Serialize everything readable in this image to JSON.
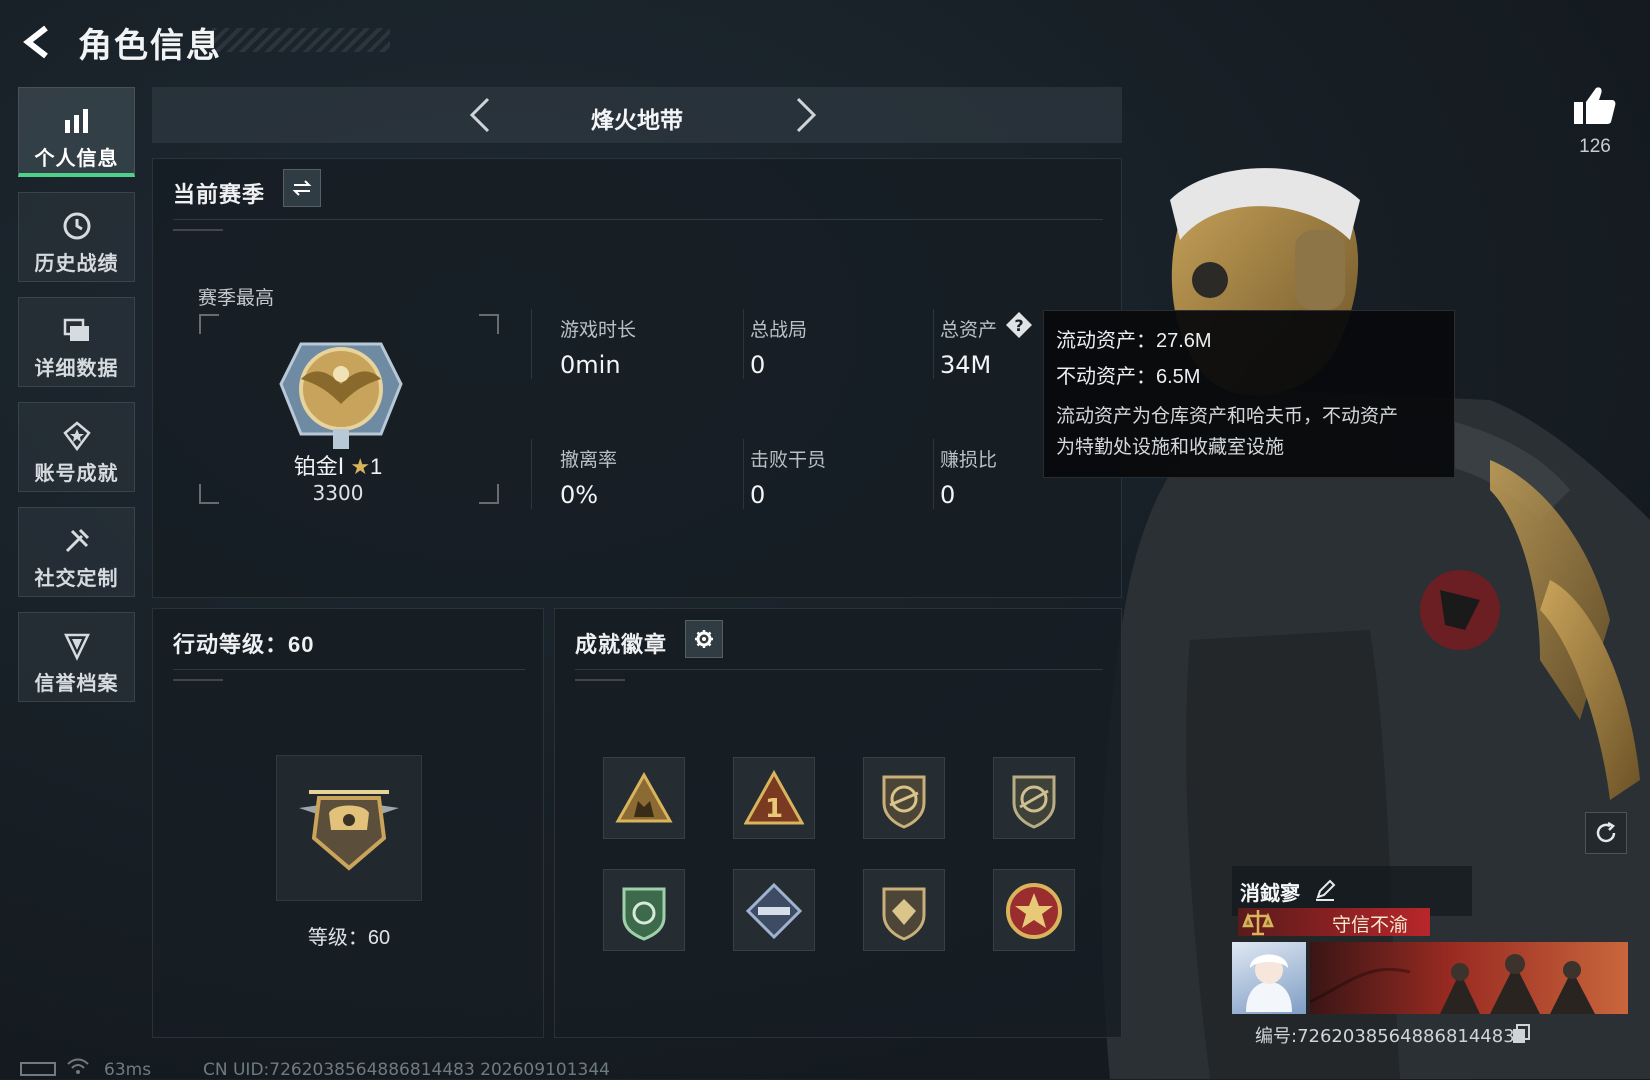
{
  "header": {
    "title": "角色信息"
  },
  "nav": {
    "items": [
      {
        "label": "个人信息",
        "icon": "bar-chart-icon",
        "active": true
      },
      {
        "label": "历史战绩",
        "icon": "clock-icon",
        "active": false
      },
      {
        "label": "详细数据",
        "icon": "cards-icon",
        "active": false
      },
      {
        "label": "账号成就",
        "icon": "medal-icon",
        "active": false
      },
      {
        "label": "社交定制",
        "icon": "tools-icon",
        "active": false
      },
      {
        "label": "信誉档案",
        "icon": "shield-icon",
        "active": false
      }
    ]
  },
  "mode": {
    "title": "烽火地带"
  },
  "season": {
    "title": "当前赛季",
    "highest_label": "赛季最高",
    "rank_name": "铂金Ⅰ",
    "rank_stars": "1",
    "rank_score": "3300",
    "stats": [
      {
        "label": "游戏时长",
        "value": "0min"
      },
      {
        "label": "总战局",
        "value": "0"
      },
      {
        "label": "总资产",
        "value": "34M"
      },
      {
        "label": "撤离率",
        "value": "0%"
      },
      {
        "label": "击败干员",
        "value": "0"
      },
      {
        "label": "赚损比",
        "value": "0"
      }
    ]
  },
  "tooltip": {
    "line1": "流动资产：27.6M",
    "line2": "不动资产：6.5M",
    "desc1": "流动资产为仓库资产和哈夫币，不动资产",
    "desc2": "为特勤处设施和收藏室设施"
  },
  "action_level": {
    "title": "行动等级：60",
    "level_text": "等级：60"
  },
  "achievements": {
    "title": "成就徽章",
    "badges": [
      "squad-badge-icon",
      "rank-one-badge-icon",
      "rifle-shield-badge-icon",
      "sniper-shield-badge-icon",
      "green-shield-badge-icon",
      "diamond-gun-badge-icon",
      "gem-shield-badge-icon",
      "star-medal-badge-icon"
    ]
  },
  "profile": {
    "like_count": "126",
    "player_name": "消鉞寥",
    "honor_title": "守信不渝",
    "card_uid": "编号:7262038564886814483"
  },
  "footer": {
    "ping": "63ms",
    "uid": "CN UID:7262038564886814483 202609101344"
  },
  "colors": {
    "accent_green": "#4fd18b",
    "honor_red": "#b8262a"
  }
}
